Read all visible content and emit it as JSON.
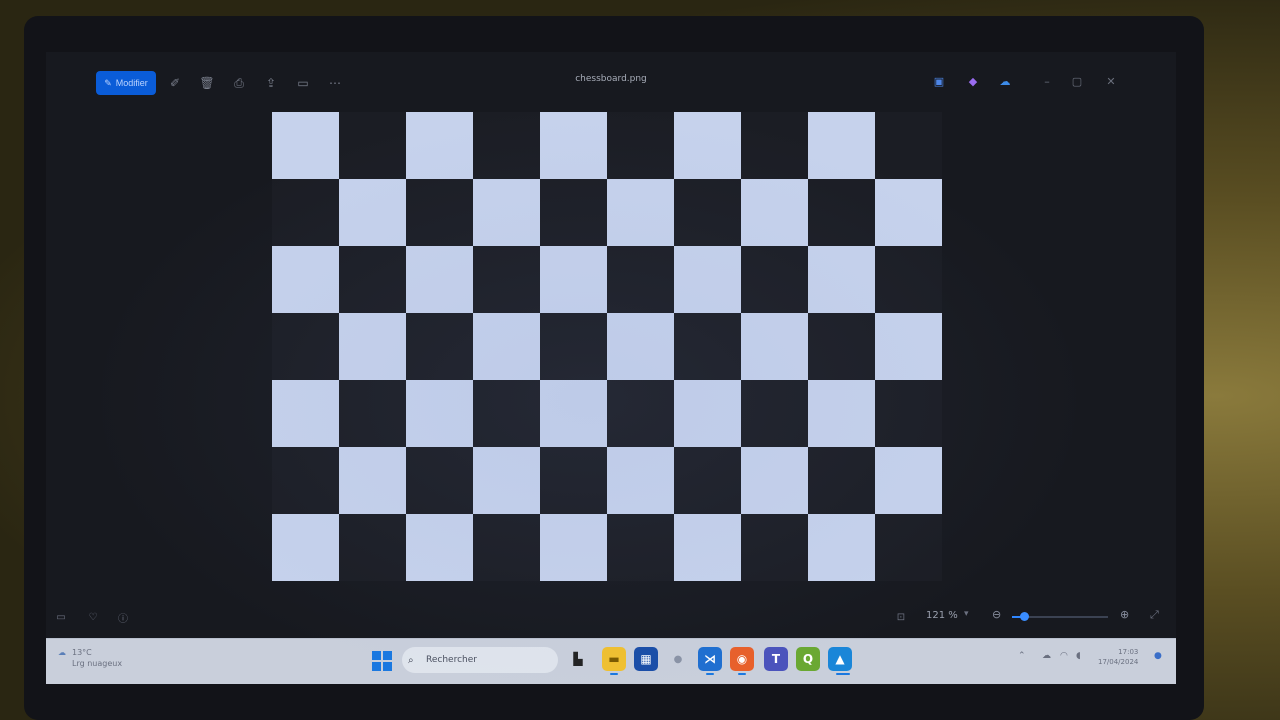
{
  "window": {
    "title": "chessboard.png",
    "edit_button_label": "Modifier",
    "toolbar_icons": [
      "edit-image-icon",
      "delete-icon",
      "print-icon",
      "share-icon",
      "slideshow-icon",
      "more-icon"
    ],
    "right_icons": [
      "person-icon",
      "copilot-icon",
      "onedrive-icon",
      "minimize-icon",
      "maximize-icon",
      "close-icon"
    ]
  },
  "image": {
    "rows": 7,
    "cols": 10,
    "light_color": "#c6d2ec",
    "dark_color": "#1b1d24"
  },
  "statusbar": {
    "zoom_label": "121 %",
    "zoom_level_fraction": 0.12
  },
  "taskbar": {
    "weather_temp": "13°C",
    "weather_desc": "Lrg nuageux",
    "search_placeholder": "Rechercher",
    "clock_time": "17:03",
    "clock_date": "17/04/2024"
  },
  "colors": {
    "accent": "#0a5cd8",
    "screen_bg": "#17191f",
    "taskbar_bg": "#c9cfdb"
  }
}
